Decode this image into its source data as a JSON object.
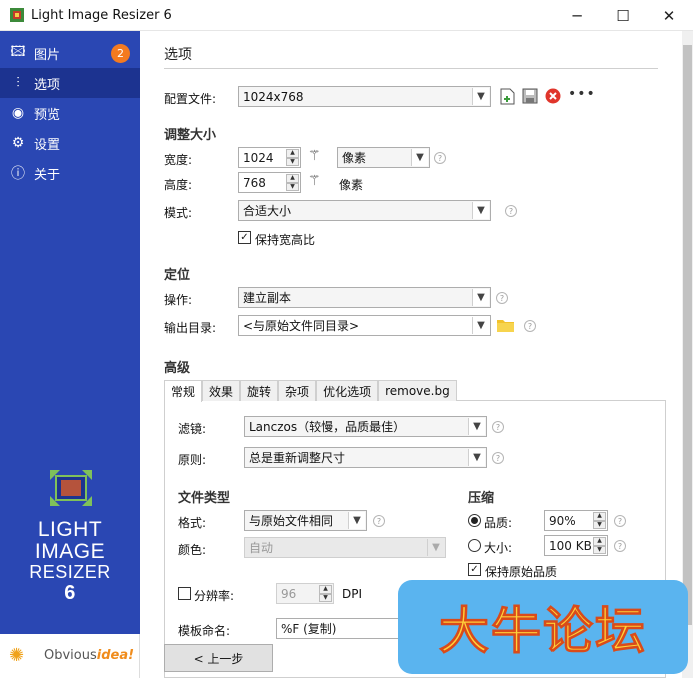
{
  "window": {
    "title": "Light Image Resizer 6",
    "minimize": "─",
    "maximize": "☐",
    "close": "✕"
  },
  "sidebar": {
    "items": [
      {
        "label": "图片",
        "icon": "images-icon"
      },
      {
        "label": "选项",
        "icon": "sliders-icon"
      },
      {
        "label": "预览",
        "icon": "eye-icon"
      },
      {
        "label": "设置",
        "icon": "gear-icon"
      },
      {
        "label": "关于",
        "icon": "info-icon"
      }
    ],
    "badge": "2",
    "logo": {
      "line1": "LIGHT",
      "line2": "IMAGE",
      "line3": "RESIZER",
      "line4": "6"
    },
    "brand": {
      "part1": "Obvious",
      "part2": "idea!"
    },
    "active_index": 1
  },
  "options": {
    "title": "选项",
    "profile": {
      "label": "配置文件:",
      "value": "1024x768"
    },
    "resize": {
      "heading": "调整大小",
      "width": {
        "label": "宽度:",
        "value": "1024"
      },
      "height": {
        "label": "高度:",
        "value": "768"
      },
      "unit": "像素",
      "unit_static": "像素",
      "mode": {
        "label": "模式:",
        "value": "合适大小"
      },
      "keep_aspect": {
        "label": "保持宽高比",
        "checked": true
      }
    },
    "target": {
      "heading": "定位",
      "action": {
        "label": "操作:",
        "value": "建立副本"
      },
      "output": {
        "label": "输出目录:",
        "value": "<与原始文件同目录>"
      }
    },
    "advanced": {
      "heading": "高级",
      "tabs": [
        "常规",
        "效果",
        "旋转",
        "杂项",
        "优化选项",
        "remove.bg"
      ],
      "filter": {
        "label": "滤镜:",
        "value": "Lanczos（较慢，品质最佳）"
      },
      "rule": {
        "label": "原则:",
        "value": "总是重新调整尺寸"
      },
      "filetype": {
        "heading": "文件类型",
        "format": {
          "label": "格式:",
          "value": "与原始文件相同"
        },
        "color": {
          "label": "颜色:",
          "value": "自动"
        }
      },
      "compression": {
        "heading": "压缩",
        "quality": {
          "label": "品质:",
          "value": "90%",
          "selected": true
        },
        "size": {
          "label": "大小:",
          "value": "100 KB",
          "selected": false
        },
        "keep_quality": {
          "label": "保持原始品质",
          "checked": true
        }
      },
      "resolution": {
        "label": "分辨率:",
        "value": "96",
        "unit": "DPI",
        "checked": false
      },
      "naming": {
        "label": "模板命名:",
        "value": "%F (复制)"
      }
    },
    "back_button": "< 上一步"
  },
  "watermark": {
    "text": "大牛论坛"
  },
  "colors": {
    "sidebar": "#2a47b3",
    "sidebar_active": "#1c3390",
    "badge": "#f47a20",
    "watermark_bg": "#5ab4ef",
    "watermark_text": "#ffd23a"
  }
}
